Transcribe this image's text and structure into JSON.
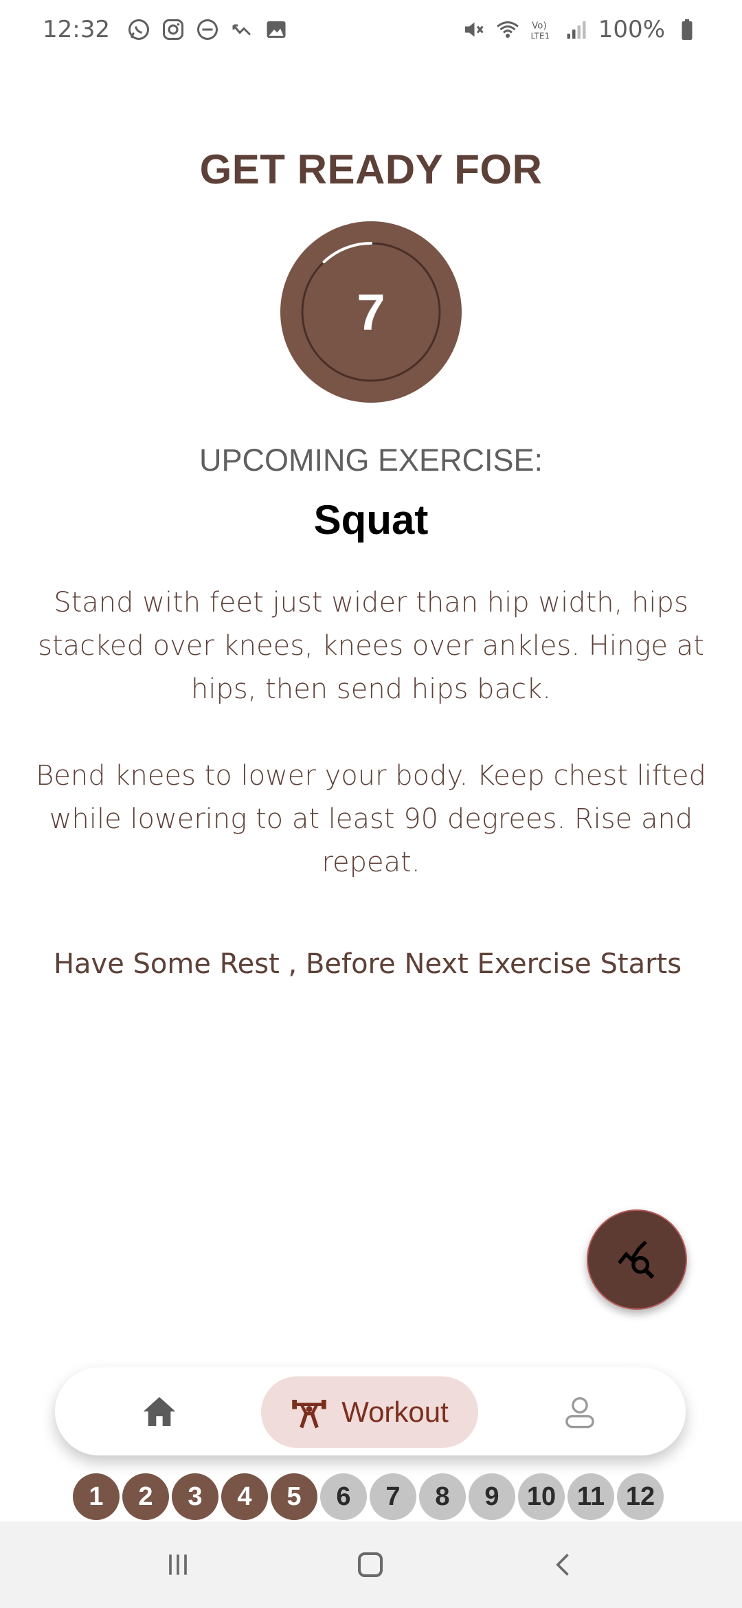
{
  "status_bar": {
    "time": "12:32",
    "battery": "100%",
    "left_icons": [
      "whatsapp-icon",
      "instagram-icon",
      "dnd-icon",
      "missed-call-icon",
      "gallery-icon"
    ],
    "right_icons": [
      "mute-icon",
      "wifi-icon",
      "volte-icon",
      "signal-icon",
      "battery-icon"
    ]
  },
  "header": {
    "title": "GET READY FOR"
  },
  "timer": {
    "value": "7",
    "progress_fraction": 0.12
  },
  "exercise": {
    "upcoming_label": "UPCOMING EXERCISE:",
    "name": "Squat",
    "description": "Stand with feet just wider than hip width, hips stacked over knees, knees over ankles. Hinge at hips, then send hips back.\n\nBend knees to lower your body. Keep chest lifted while lowering to at least 90 degrees. Rise and repeat.",
    "rest_note": "Have Some Rest , Before Next Exercise Starts"
  },
  "fab": {
    "icon": "analytics-search-icon"
  },
  "bottom_nav": {
    "home_icon": "home-icon",
    "workout_label": "Workout",
    "workout_icon": "weightlifter-icon",
    "profile_icon": "person-icon"
  },
  "steps": {
    "completed": 5,
    "items": [
      "1",
      "2",
      "3",
      "4",
      "5",
      "6",
      "7",
      "8",
      "9",
      "10",
      "11",
      "12"
    ]
  },
  "colors": {
    "primary": "#795548",
    "dark_brown": "#5d4037",
    "nav_pill": "#f0dcda",
    "workout_accent": "#7a2e1e",
    "pending_step": "#c4c4c4"
  }
}
